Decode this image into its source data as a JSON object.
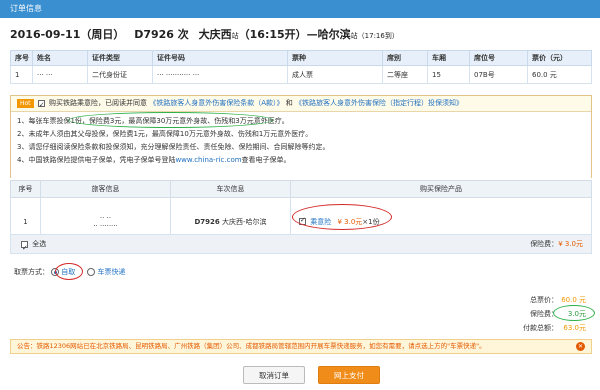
{
  "header": {
    "title": "订单信息"
  },
  "train": {
    "date_weekday": "2016-09-11（周日）",
    "train_no": "D7926 次",
    "from": "大庆西",
    "from_suffix": "站",
    "depart": "（16:15开）",
    "to_connector": "—哈尔滨",
    "to_suffix": "站",
    "arrive": "（17:16到）"
  },
  "passenger_table": {
    "headers": [
      "序号",
      "姓名",
      "证件类型",
      "证件号码",
      "票种",
      "席别",
      "车厢",
      "席位号",
      "票价（元）"
    ],
    "rows": [
      {
        "no": "1",
        "name": "··· ···",
        "id_type": "二代身份证",
        "id_no": "··· ··········· ···",
        "ticket_type": "成人票",
        "seat_class": "二等座",
        "car": "15",
        "seat": "07B号",
        "price": "60.0 元"
      }
    ]
  },
  "insurance": {
    "hot_label": "Hot",
    "agree_text": "购买铁路乘意险，已阅读并同意",
    "link1": "《铁路旅客人身意外伤害保险条款（A款）》",
    "and_text": "和",
    "link2": "《铁路旅客人身意外伤害保险（指定行程）投保须知》",
    "lines": [
      "1、每张车票投保1份，保险费3元，最高保障30万元意外身故、伤残和3万元意外医疗。",
      "2、未成年人须由其父母投保，保险费1元，最高保障10万元意外身故、伤残和1万元意外医疗。",
      "3、请您仔细阅读保险条款和投保须知，充分理解保险责任、责任免除、保险期间、合同解除等约定。"
    ],
    "line4_prefix": "4、中国铁路保险提供电子保单，凭电子保单号登陆",
    "line4_link": "www.china-ric.com",
    "line4_suffix": "查看电子保单。"
  },
  "insurance_table": {
    "headers": [
      "序号",
      "旅客信息",
      "车次信息",
      "购买保险产品"
    ],
    "row": {
      "no": "1",
      "passenger_line1": "·· ··",
      "passenger_line2": "·· ········",
      "train_no": "D7926",
      "route": "大庆西-哈尔滨",
      "product": "乘意险",
      "price": "¥ 3.0元",
      "qty": "×1份"
    }
  },
  "select_all": {
    "label": "全选",
    "fee_label": "保险费：",
    "fee_value": "¥ 3.0元"
  },
  "pickup": {
    "label": "取票方式：",
    "option1": "自取",
    "option2": "车票快递"
  },
  "summary": {
    "ticket_label": "总票价：",
    "ticket_value": "60.0 元",
    "insurance_label": "保险费：",
    "insurance_value": "3.0元",
    "total_label": "付款总额：",
    "total_value": "63.0元"
  },
  "notice": {
    "text": "公告：铁路12306网站已在北京铁路局、昆明铁路局、广州铁路（集团）公司、成都铁路局管辖范围内开展车票快递服务，如您有需要，请点选上方的\"车票快递\"。"
  },
  "buttons": {
    "cancel": "取消订单",
    "pay": "网上支付"
  },
  "colors": {
    "header": "#3a8fd1",
    "accent": "#f39800",
    "link": "#1f6fc0",
    "annot_green": "#2eb04a",
    "annot_red": "#d42a2a"
  }
}
